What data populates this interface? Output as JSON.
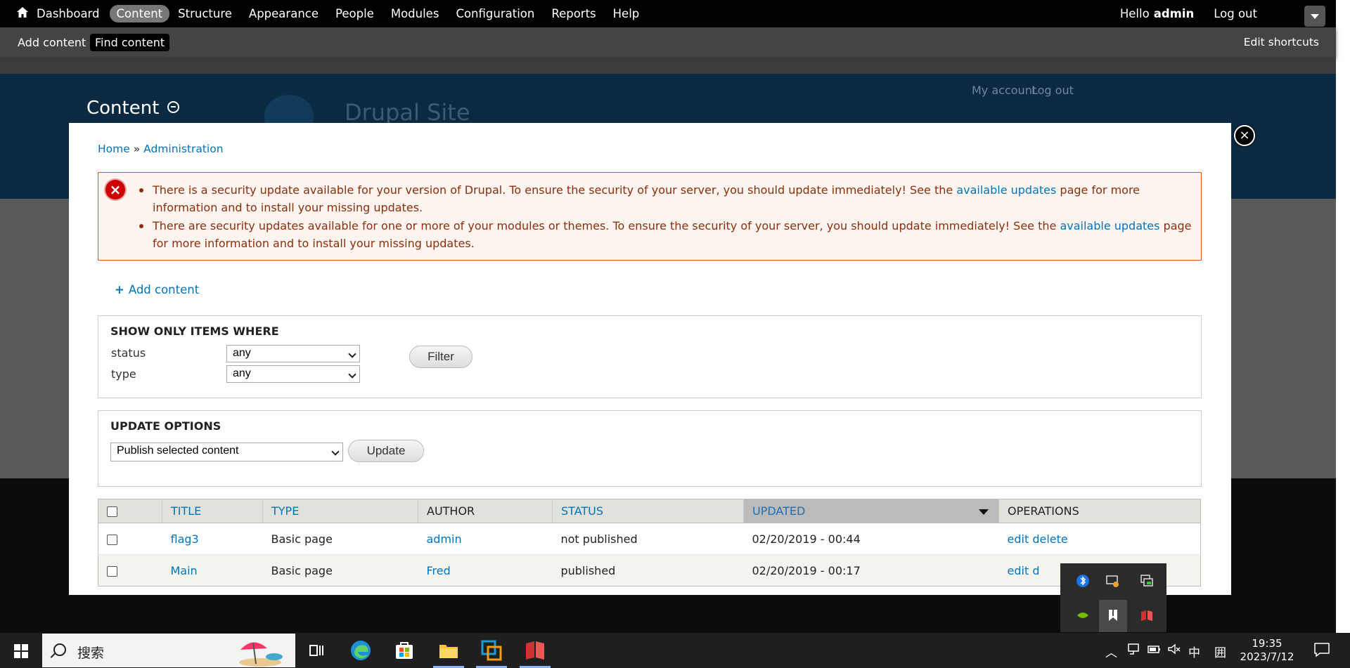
{
  "toolbar": {
    "menu": [
      "Dashboard",
      "Content",
      "Structure",
      "Appearance",
      "People",
      "Modules",
      "Configuration",
      "Reports",
      "Help"
    ],
    "hello": "Hello",
    "user": "admin",
    "logout": "Log out"
  },
  "shortcuts": {
    "add_content": "Add content",
    "find_content": "Find content",
    "edit_shortcuts": "Edit shortcuts"
  },
  "background": {
    "my_account": "My account",
    "log_out": "Log out",
    "site_name": "Drupal Site"
  },
  "overlay": {
    "title": "Content",
    "close_symbol": "×"
  },
  "breadcrumb": {
    "home": "Home",
    "sep": " » ",
    "admin": "Administration"
  },
  "messages": {
    "m1_before": "There is a security update available for your version of Drupal. To ensure the security of your server, you should update immediately! See the ",
    "m1_link": "available updates",
    "m1_after": " page for more information and to install your missing updates.",
    "m2_before": "There are security updates available for one or more of your modules or themes. To ensure the security of your server, you should update immediately! See the ",
    "m2_link": "available updates",
    "m2_after": " page for more information and to install your missing updates."
  },
  "add_content_link": "Add content",
  "filters": {
    "legend": "SHOW ONLY ITEMS WHERE",
    "status_label": "status",
    "status_value": "any",
    "type_label": "type",
    "type_value": "any",
    "filter_button": "Filter"
  },
  "update_options": {
    "legend": "UPDATE OPTIONS",
    "action_value": "Publish selected content",
    "update_button": "Update"
  },
  "table": {
    "headers": {
      "title": "TITLE",
      "type": "TYPE",
      "author": "AUTHOR",
      "status": "STATUS",
      "updated": "UPDATED",
      "operations": "OPERATIONS"
    },
    "rows": [
      {
        "title": "flag3",
        "type": "Basic page",
        "author": "admin",
        "status": "not published",
        "updated": "02/20/2019 - 00:44",
        "edit": "edit",
        "delete": "delete"
      },
      {
        "title": "Main",
        "type": "Basic page",
        "author": "Fred",
        "status": "published",
        "updated": "02/20/2019 - 00:17",
        "edit": "edit",
        "delete": "d"
      }
    ]
  },
  "taskbar": {
    "search_placeholder": "搜索",
    "time": "19:35",
    "date": "2023/7/12",
    "ime": "中",
    "ime2": "囲"
  }
}
